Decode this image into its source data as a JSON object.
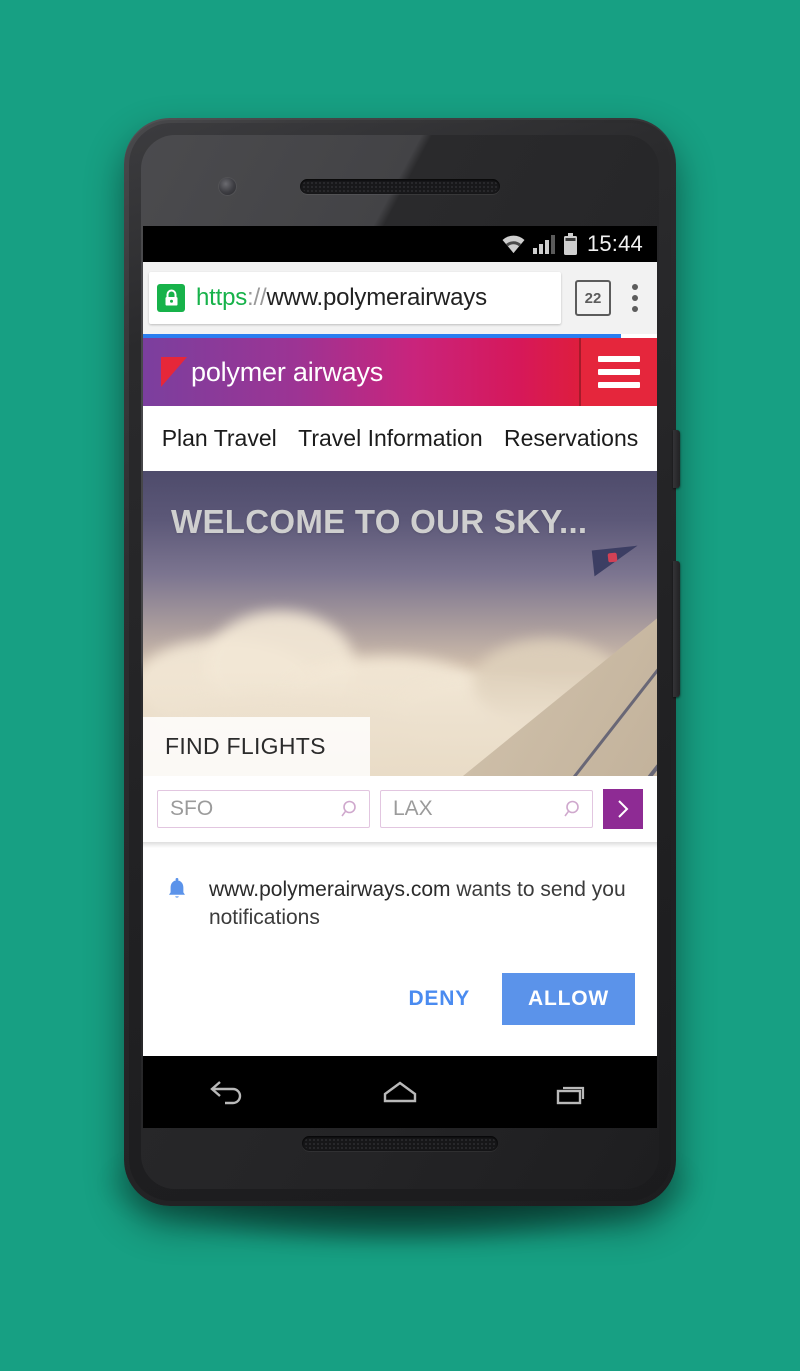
{
  "device": {
    "status_bar": {
      "time": "15:44",
      "icons": [
        "wifi-icon",
        "signal-icon",
        "battery-icon"
      ]
    },
    "nav_bar": {
      "back_label": "Back",
      "home_label": "Home",
      "recents_label": "Recent apps"
    }
  },
  "browser": {
    "security_icon": "lock-icon",
    "url_scheme": "https",
    "url_separator": "://",
    "url_host": "www.polymerairways",
    "url_full": "https://www.polymerairway",
    "tab_count": "22",
    "menu_icon": "kebab-menu-icon",
    "progress_percent": 93
  },
  "site": {
    "brand": {
      "logo_icon": "pennant-logo-icon",
      "name": "polymer airways"
    },
    "menu_button_icon": "hamburger-menu-icon",
    "nav_items": [
      {
        "label": "Plan Travel"
      },
      {
        "label": "Travel Information"
      },
      {
        "label": "Reservations"
      }
    ],
    "hero": {
      "title": "WELCOME TO OUR SKY...",
      "tab_label": "FIND FLIGHTS"
    },
    "search": {
      "origin_value": "SFO",
      "origin_placeholder": "SFO",
      "destination_value": "LAX",
      "destination_placeholder": "LAX",
      "search_icon": "magnifier-icon",
      "submit_icon": "chevron-right-icon"
    },
    "colors": {
      "brand_gradient_start": "#7b3f9e",
      "brand_gradient_end": "#de1d3e",
      "menu_red": "#e5263c",
      "accent_purple": "#8e2b94",
      "field_border": "#e2c6e0",
      "progress_blue": "#2a7ef0",
      "lock_green": "#17b24a"
    }
  },
  "permission_dialog": {
    "icon": "bell-icon",
    "domain": "www.polymerairways.com",
    "message_rest": "wants to send you notifications",
    "message_full": "www.polymerairways.com wants to send you notifications",
    "deny_label": "DENY",
    "allow_label": "ALLOW",
    "allow_color": "#5b93ea",
    "deny_color": "#4a8bf0"
  }
}
